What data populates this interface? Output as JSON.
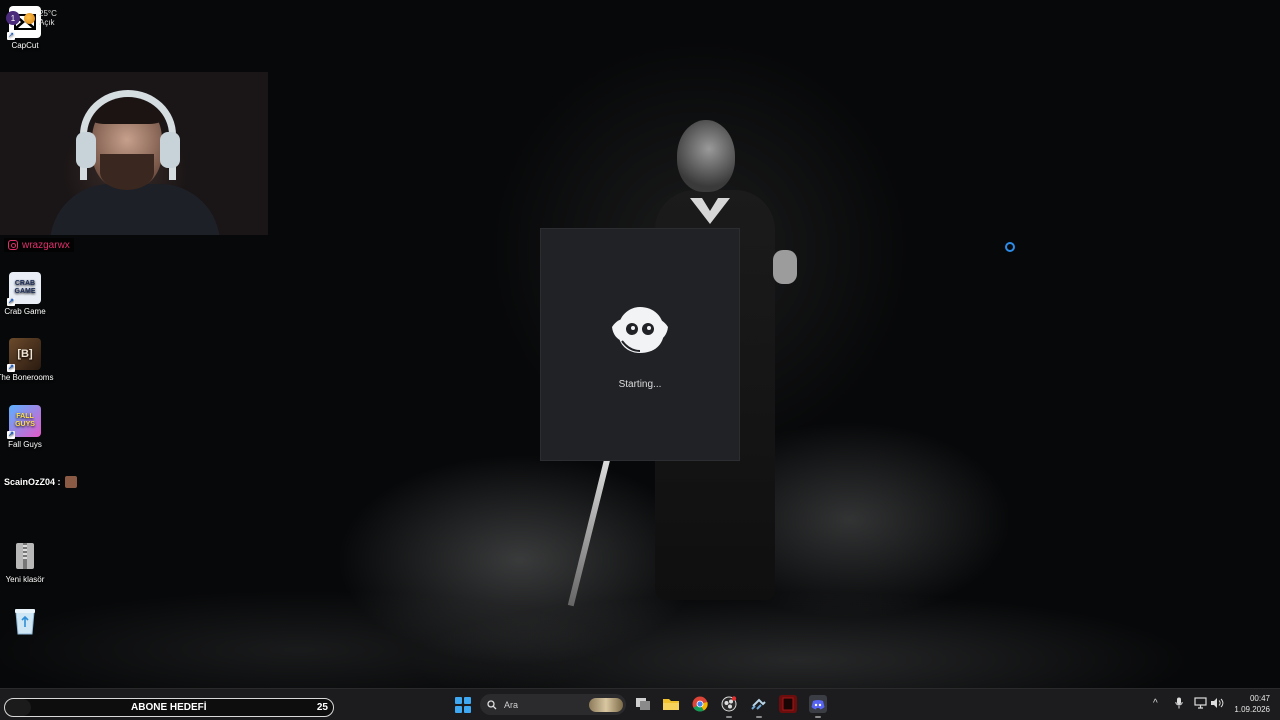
{
  "desktop": {
    "icons": [
      {
        "label": "CapCut",
        "icon": "capcut-icon"
      },
      {
        "label": "Crab Game",
        "icon": "crab-game-icon",
        "art": "CRAB GAME"
      },
      {
        "label": "The Bonerooms",
        "icon": "bonerooms-icon",
        "art": "[B]"
      },
      {
        "label": "Fall Guys",
        "icon": "fall-guys-icon",
        "art": "FALL GUYS"
      },
      {
        "label": "Yeni klasör",
        "icon": "zip-folder-icon"
      },
      {
        "label": "",
        "icon": "recycle-bin-icon"
      }
    ]
  },
  "stream_overlay": {
    "instagram_handle": "wrazgarwx",
    "chat_user": "ScainOzZ04 :"
  },
  "splash": {
    "app": "Discord",
    "status": "Starting...",
    "bg": "#202225"
  },
  "taskbar": {
    "weather_badge": "1",
    "weather_temp": "25°C",
    "weather_desc": "Açık",
    "goal_label": "ABONE HEDEFİ",
    "goal_count": "25",
    "search_placeholder": "Ara",
    "apps": [
      {
        "name": "task-view-icon"
      },
      {
        "name": "file-explorer-icon"
      },
      {
        "name": "chrome-icon"
      },
      {
        "name": "obs-icon"
      },
      {
        "name": "steam-icon"
      },
      {
        "name": "red-app-icon"
      },
      {
        "name": "discord-icon"
      }
    ],
    "tray": [
      "^",
      "mic-icon",
      "network-icon",
      "volume-icon"
    ],
    "time": "00:47",
    "date": "1.09.2026"
  },
  "colors": {
    "accent": "#3ea8f2",
    "discord": "#5865f2",
    "instagram": "#e1306c",
    "spinner": "#2d8ce8"
  }
}
